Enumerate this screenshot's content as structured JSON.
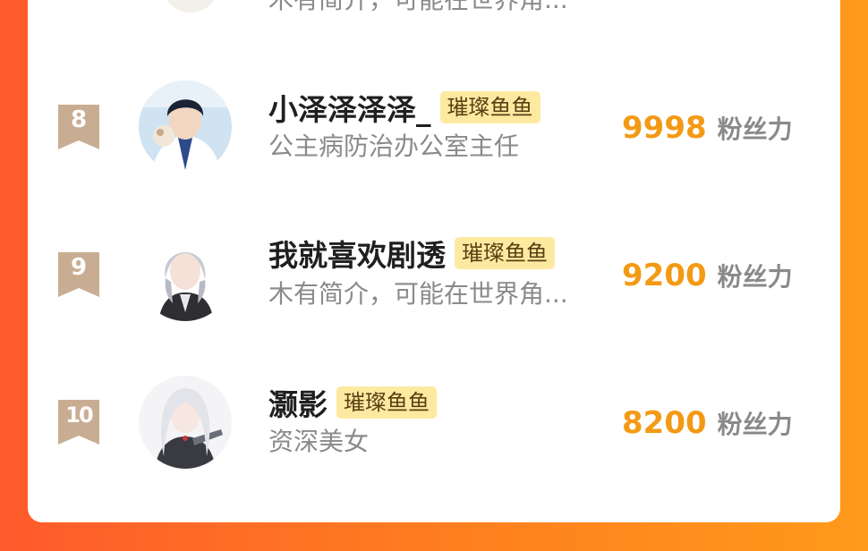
{
  "list": {
    "top_partial": {
      "bio": "木有简介，可能在世界角..."
    },
    "rows": [
      {
        "rank": "8",
        "name": "小泽泽泽泽_",
        "badge": "璀璨鱼鱼",
        "bio": "公主病防治办公室主任",
        "fans": "9998",
        "fans_label": "粉丝力"
      },
      {
        "rank": "9",
        "name": "我就喜欢剧透",
        "badge": "璀璨鱼鱼",
        "bio": "木有简介，可能在世界角...",
        "fans": "9200",
        "fans_label": "粉丝力"
      },
      {
        "rank": "10",
        "name": "灏影",
        "badge": "璀璨鱼鱼",
        "bio": "资深美女",
        "fans": "8200",
        "fans_label": "粉丝力"
      }
    ]
  },
  "colors": {
    "rank_ribbon": "#c9ad93",
    "badge_bg": "#fdeaa0",
    "fans_number": "#f39a15",
    "background_start": "#ff5a2c",
    "background_end": "#ff9a1a"
  },
  "icons": {
    "rank": "ribbon-bookmark-icon"
  }
}
